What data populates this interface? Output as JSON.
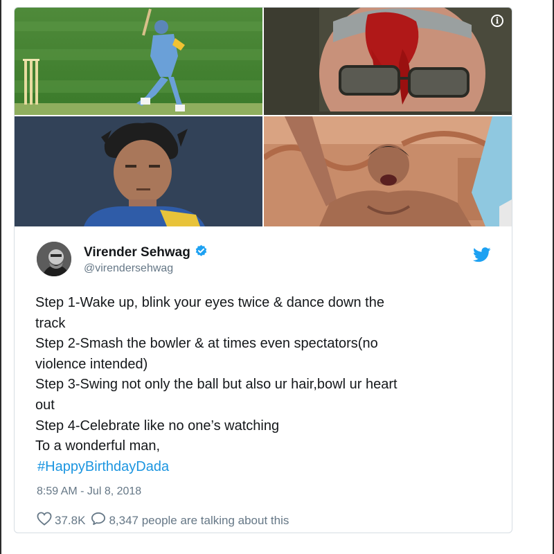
{
  "tweet": {
    "author": {
      "display_name": "Virender Sehwag",
      "handle": "@virendersehwag",
      "verified": true
    },
    "text_lines": [
      "Step 1-Wake up, blink your eyes twice & dance down the",
      "track",
      "Step 2-Smash the bowler & at times even spectators(no",
      "violence intended)",
      "Step 3-Swing not only the ball but also ur hair,bowl ur heart",
      "out",
      "Step 4-Celebrate like no one’s watching",
      "To a wonderful man,"
    ],
    "hashtag": "#HappyBirthdayDada",
    "timestamp": "8:59 AM - Jul 8, 2018",
    "likes": "37.8K",
    "talking": "8,347 people are talking about this"
  },
  "icons": {
    "info": "info-icon",
    "verified": "verified-badge-icon",
    "brand": "twitter-bird-icon",
    "like": "heart-icon",
    "reply": "speech-bubble-icon"
  },
  "colors": {
    "brand_blue": "#1da1f2",
    "link_blue": "#1b95e0",
    "text_primary": "#14171a",
    "text_secondary": "#657786",
    "card_border": "#d6dde3"
  }
}
